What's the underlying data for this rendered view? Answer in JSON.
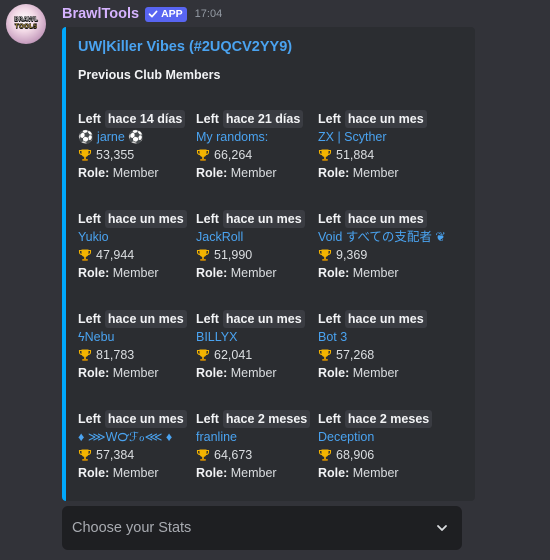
{
  "message": {
    "username": "BrawlTools",
    "badge": "APP",
    "timestamp": "17:04",
    "avatar_text": [
      "BRAWL",
      "TOOLS"
    ]
  },
  "embed": {
    "title": "UW|Killer Vibes (#2UQCV2YY9)",
    "description": "Previous Club Members",
    "accent_color": "#00a8fc",
    "left_label": "Left",
    "trophy_icon": "trophy-icon",
    "role_label": "Role:",
    "fields": [
      {
        "when": "hace 14 días",
        "name": "⚽ jarne ⚽",
        "trophies": "53,355",
        "role": "Member"
      },
      {
        "when": "hace 21 días",
        "name": "My randoms:",
        "trophies": "66,264",
        "role": "Member"
      },
      {
        "when": "hace un mes",
        "name": "ZX | Scyther",
        "trophies": "51,884",
        "role": "Member"
      },
      {
        "when": "hace un mes",
        "name": "Yukio",
        "trophies": "47,944",
        "role": "Member"
      },
      {
        "when": "hace un mes",
        "name": "JackRoll",
        "trophies": "51,990",
        "role": "Member"
      },
      {
        "when": "hace un mes",
        "name": "Void すべての支配者 ❦",
        "trophies": "9,369",
        "role": "Member"
      },
      {
        "when": "hace un mes",
        "name": "ϟNebu",
        "trophies": "81,783",
        "role": "Member"
      },
      {
        "when": "hace un mes",
        "name": "BILLYX",
        "trophies": "62,041",
        "role": "Member"
      },
      {
        "when": "hace un mes",
        "name": "Bot 3",
        "trophies": "57,268",
        "role": "Member"
      },
      {
        "when": "hace un mes",
        "name": "♦ ⋙W℺ℱℴ⋘ ♦",
        "trophies": "57,384",
        "role": "Member"
      },
      {
        "when": "hace 2 meses",
        "name": "franline",
        "trophies": "64,673",
        "role": "Member"
      },
      {
        "when": "hace 2 meses",
        "name": "Deception",
        "trophies": "68,906",
        "role": "Member"
      }
    ]
  },
  "select": {
    "placeholder": "Choose your Stats",
    "icon": "chevron-down-icon"
  }
}
